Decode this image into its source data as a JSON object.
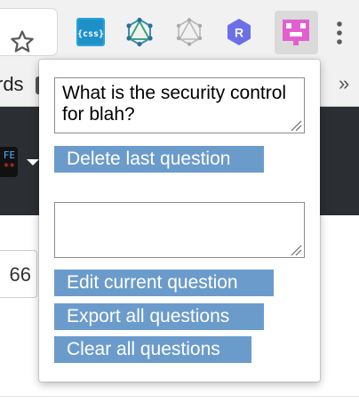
{
  "toolbar": {
    "star_icon": "bookmark-star-icon",
    "extensions": [
      {
        "name": "css-extension-icon",
        "label": "{css}",
        "color": "#29a3d9"
      },
      {
        "name": "graphql-extension-icon",
        "color": "#3b8db8"
      },
      {
        "name": "graphql-grey-extension-icon",
        "color": "#b8b8b8"
      },
      {
        "name": "r-extension-icon",
        "label": "R",
        "color": "#6c6fe6"
      },
      {
        "name": "pink-extension-icon",
        "color": "#e35fd0"
      }
    ],
    "menu_icon": "kebab-menu-icon"
  },
  "bookmarks_bar": {
    "partial_text": "rds",
    "more_glyph": "»"
  },
  "page": {
    "logo_text_top": "FE",
    "logo_text_bottom": "**",
    "partial_input_value": "66"
  },
  "popup": {
    "question_text": "What is the security control for blah?",
    "edit_text": "",
    "delete_button": "Delete last question",
    "edit_button": "Edit current question",
    "export_button": "Export all questions",
    "clear_button": "Clear all questions",
    "button_color": "#6b9bcb"
  }
}
